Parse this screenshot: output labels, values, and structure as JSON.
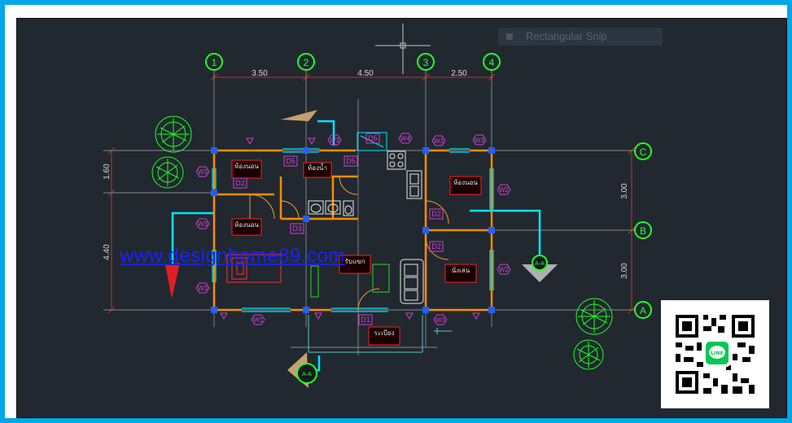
{
  "snip_tool": {
    "label": "Rectangular Snip"
  },
  "watermark": {
    "text": "www.designhome89.com"
  },
  "grid": {
    "columns": [
      "1",
      "2",
      "3",
      "4"
    ],
    "rows": [
      "C",
      "B",
      "A"
    ],
    "col_dims": [
      "3.50",
      "4.50",
      "2.50"
    ],
    "row_dims": [
      "3.00",
      "3.00"
    ],
    "left_dims": [
      "1.60",
      "4.40"
    ]
  },
  "tags": {
    "doors": [
      "D5",
      "D5",
      "D5",
      "D2",
      "D3",
      "D2",
      "D2",
      "D1"
    ],
    "windows": [
      "W3",
      "W4",
      "W3",
      "W3",
      "W3",
      "W3",
      "W3",
      "W2",
      "W2",
      "W1",
      "W3"
    ],
    "section": "A-A"
  },
  "room_labels": [
    "ห้องนอน",
    "ห้องน้ำ",
    "ห้องนอน",
    "ห้องนอน",
    "นั่งเล่น",
    "รับแขก",
    "ระเบียง"
  ],
  "qr": {
    "badge": "LINE"
  },
  "colors": {
    "background": "#212830",
    "frame": "#00a8e8",
    "walls": "#ff8c00",
    "section_line": "#00e5ff",
    "grid_bubble": "#22ff22",
    "dimension": "#ff3030",
    "tag": "#d040d0",
    "link": "#1a22ff"
  }
}
